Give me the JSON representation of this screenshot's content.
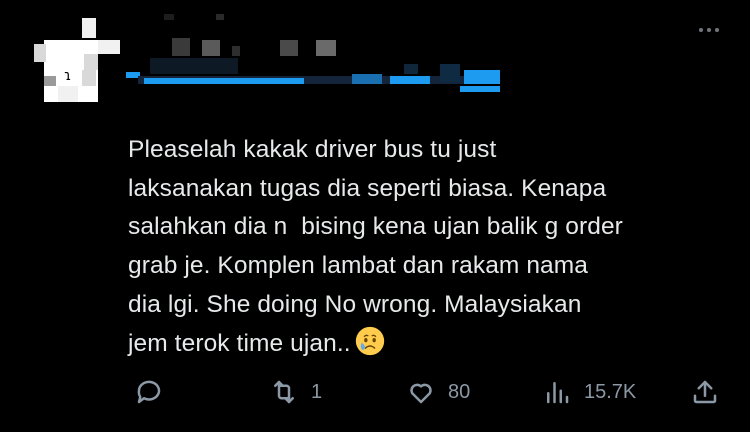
{
  "tweet": {
    "author_name": "",
    "author_handle": "",
    "text_lines": [
      "Pleaselah kakak driver bus tu just",
      "laksanakan tugas dia seperti biasa. Kenapa",
      "salahkan dia n  bising kena ujan balik g order",
      "grab je. Komplen lambat dan rakam nama",
      "dia lgi. She doing No wrong. Malaysiakan",
      "jem terok time ujan.."
    ],
    "emoji": "crying-face-emoji",
    "more_icon": "more-horizontal-icon"
  },
  "actions": {
    "reply": {
      "icon": "reply-icon",
      "count": ""
    },
    "retweet": {
      "icon": "retweet-icon",
      "count": "1"
    },
    "like": {
      "icon": "heart-icon",
      "count": "80"
    },
    "views": {
      "icon": "views-icon",
      "count": "15.7K"
    },
    "share": {
      "icon": "share-icon",
      "count": ""
    }
  },
  "colors": {
    "background": "#000000",
    "text": "#e7e9ea",
    "muted": "#8b98a5",
    "link_blue": "#1d9bf0"
  }
}
